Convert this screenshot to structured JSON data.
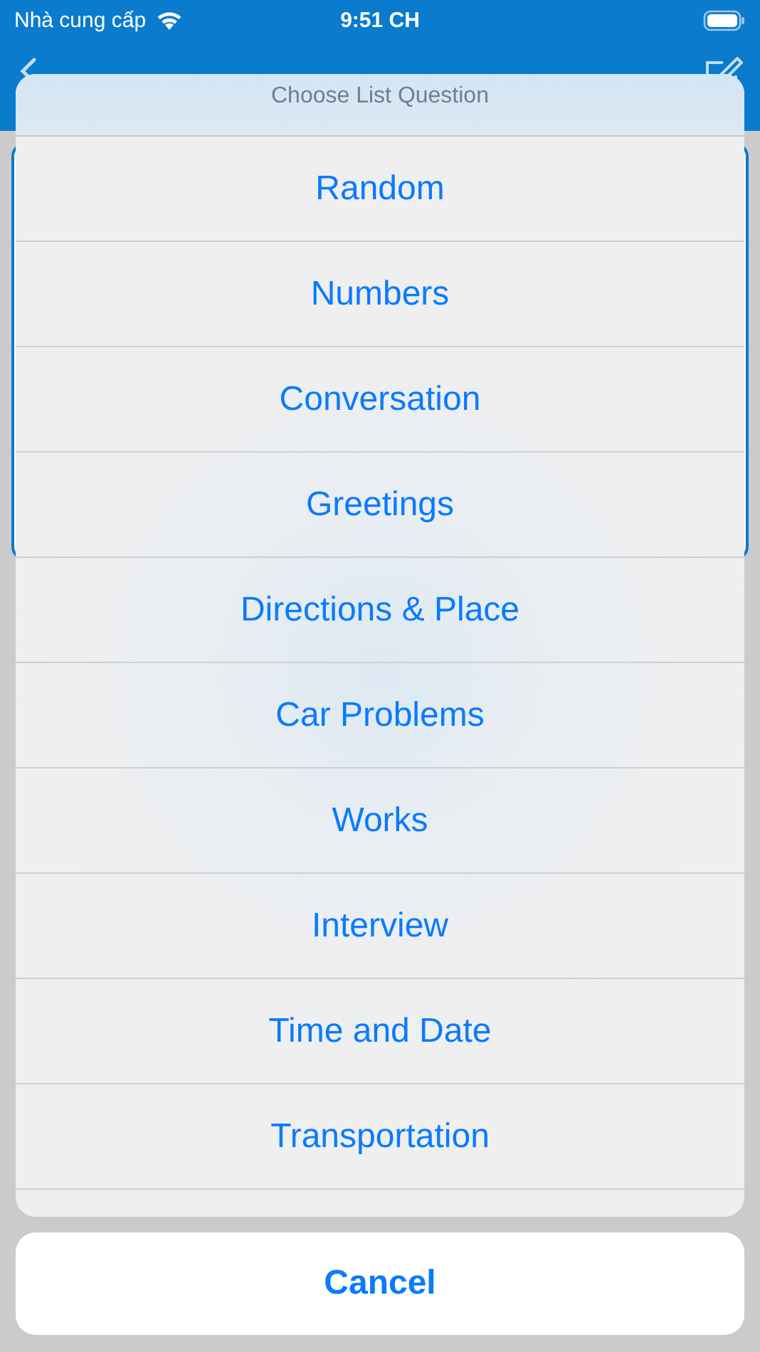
{
  "status_bar": {
    "carrier": "Nhà cung cấp",
    "time": "9:51 CH"
  },
  "action_sheet": {
    "title": "Choose List Question",
    "options": [
      "Random",
      "Numbers",
      "Conversation",
      "Greetings",
      "Directions & Place",
      "Car Problems",
      "Works",
      "Interview",
      "Time and Date",
      "Transportation"
    ],
    "cancel": "Cancel"
  }
}
